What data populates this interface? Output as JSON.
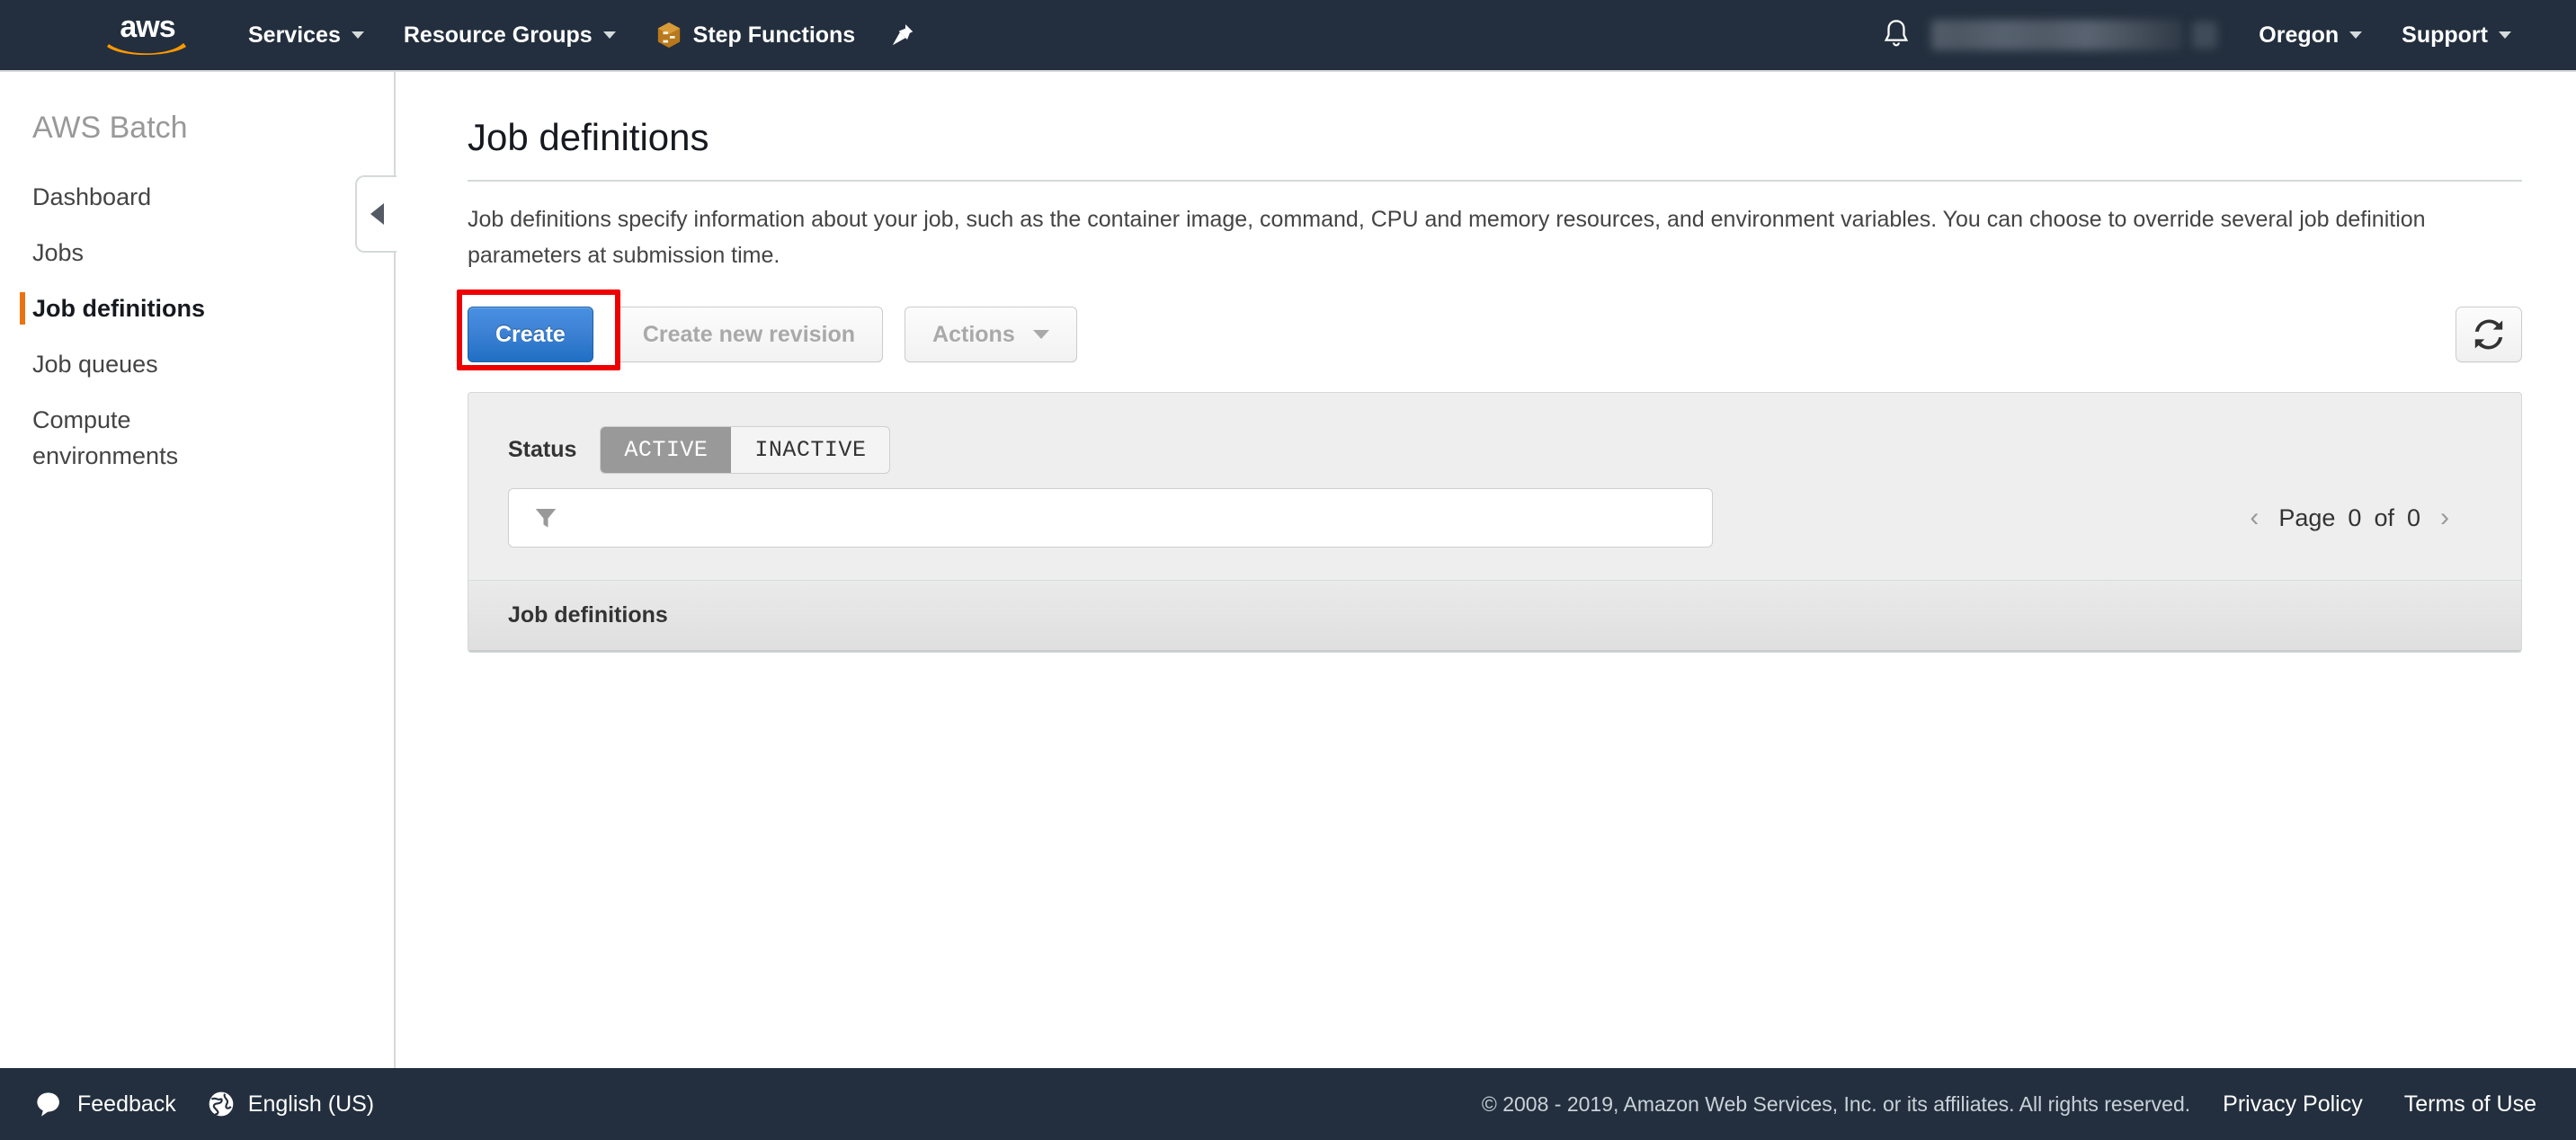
{
  "topnav": {
    "logo_text": "aws",
    "logo_icon": "aws-smile-logo",
    "services_label": "Services",
    "resource_groups_label": "Resource Groups",
    "step_functions_label": "Step Functions",
    "step_functions_icon": "step-functions-icon",
    "pin_icon": "pin-icon",
    "bell_icon": "bell-notification-icon",
    "account_label": "",
    "region_label": "Oregon",
    "support_label": "Support",
    "caret_icon": "chevron-down-icon",
    "bg_color": "#232f3e"
  },
  "sidebar": {
    "title": "AWS Batch",
    "collapse_icon": "caret-left-icon",
    "active_indicator_color": "#ec7211",
    "items": [
      {
        "label": "Dashboard",
        "active": false
      },
      {
        "label": "Jobs",
        "active": false
      },
      {
        "label": "Job definitions",
        "active": true
      },
      {
        "label": "Job queues",
        "active": false
      },
      {
        "label": "Compute environments",
        "active": false
      }
    ]
  },
  "main": {
    "page_title": "Job definitions",
    "description": "Job definitions specify information about your job, such as the container image, command, CPU and memory resources, and environment variables. You can choose to override several job definition parameters at submission time.",
    "actions": {
      "create_label": "Create",
      "create_highlighted": true,
      "highlight_color": "#ee0000",
      "create_button_color": "#3d82d4",
      "create_new_revision_label": "Create new revision",
      "create_new_revision_disabled": true,
      "actions_label": "Actions",
      "actions_disabled": true,
      "actions_caret_icon": "chevron-down-icon",
      "refresh_icon": "refresh-icon"
    },
    "filters": {
      "status_label": "Status",
      "status_options": [
        {
          "label": "ACTIVE",
          "selected": true
        },
        {
          "label": "INACTIVE",
          "selected": false
        }
      ],
      "search_icon": "filter-funnel-icon",
      "search_value": "",
      "search_placeholder": ""
    },
    "pagination": {
      "prev_icon": "chevron-left-icon",
      "next_icon": "chevron-right-icon",
      "page_word": "Page",
      "current_page": "0",
      "of_word": "of",
      "total_pages": "0"
    },
    "table": {
      "header_label": "Job definitions",
      "rows": []
    }
  },
  "footer": {
    "feedback_icon": "speech-bubble-icon",
    "feedback_label": "Feedback",
    "language_icon": "globe-icon",
    "language_label": "English (US)",
    "copyright": "© 2008 - 2019, Amazon Web Services, Inc. or its affiliates. All rights reserved.",
    "privacy_label": "Privacy Policy",
    "terms_label": "Terms of Use"
  }
}
